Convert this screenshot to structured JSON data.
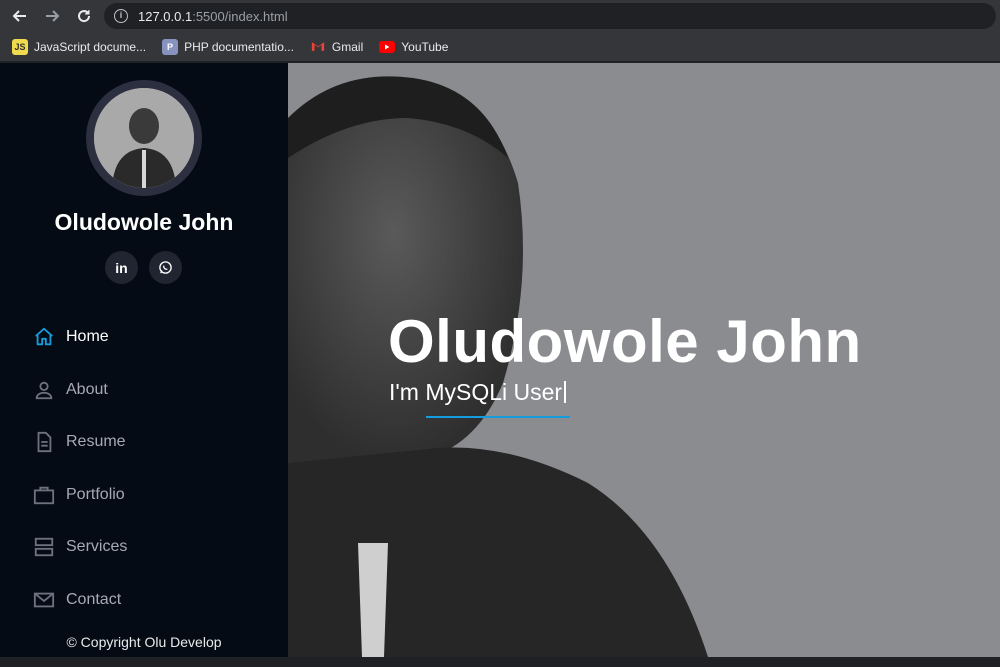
{
  "browser": {
    "url_host": "127.0.0.1",
    "url_path": ":5500/index.html",
    "bookmarks": [
      {
        "label": "JavaScript docume...",
        "icon": "js-doc-icon"
      },
      {
        "label": "PHP documentatio...",
        "icon": "php-doc-icon"
      },
      {
        "label": "Gmail",
        "icon": "gmail-icon"
      },
      {
        "label": "YouTube",
        "icon": "youtube-icon"
      }
    ]
  },
  "sidebar": {
    "name": "Oludowole John",
    "socials": [
      "linkedin-icon",
      "whatsapp-icon"
    ],
    "linkedin_glyph": "in",
    "menu": [
      {
        "label": "Home",
        "icon": "home-icon",
        "active": true
      },
      {
        "label": "About",
        "icon": "person-icon"
      },
      {
        "label": "Resume",
        "icon": "file-icon"
      },
      {
        "label": "Portfolio",
        "icon": "briefcase-icon"
      },
      {
        "label": "Services",
        "icon": "server-icon"
      },
      {
        "label": "Contact",
        "icon": "envelope-icon"
      }
    ],
    "copyright": "© Copyright Olu Develop"
  },
  "hero": {
    "title": "Oludowole John",
    "subtitle": "I'm MySQLi User"
  },
  "colors": {
    "accent": "#149ddd",
    "sidebar_bg": "#040b14",
    "hero_bg": "#8b8c90"
  }
}
